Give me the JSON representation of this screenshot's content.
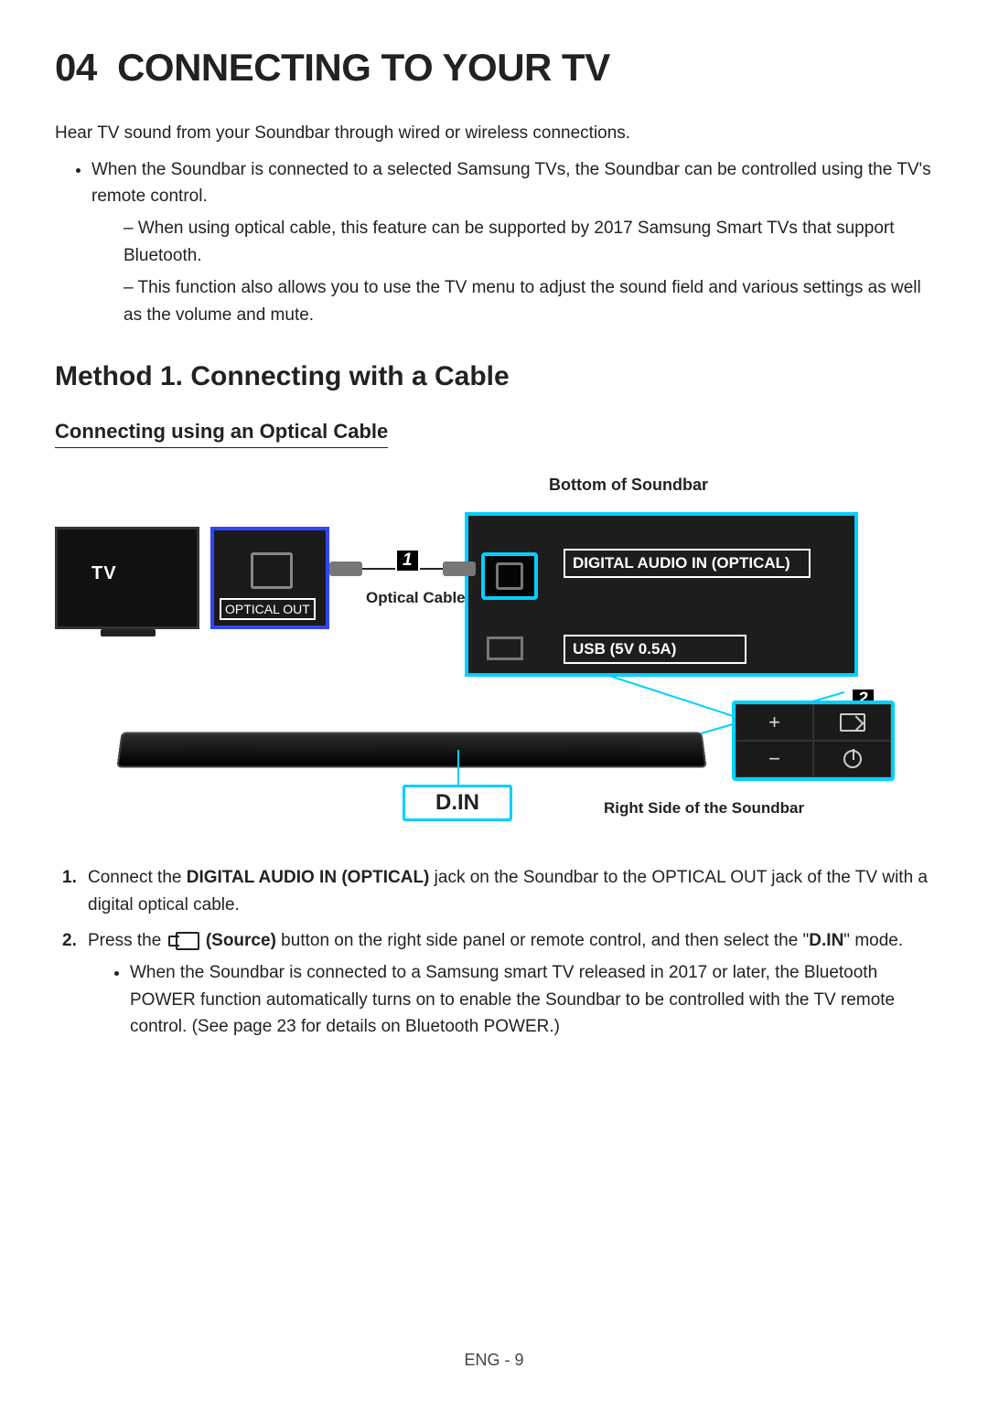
{
  "section_number": "04",
  "section_title": "CONNECTING TO YOUR TV",
  "intro": "Hear TV sound from your Soundbar through wired or wireless connections.",
  "bullets": [
    "When the Soundbar is connected to a selected Samsung TVs, the Soundbar can be controlled using the TV's remote control."
  ],
  "dashes": [
    "When using optical cable, this feature can be supported by 2017 Samsung Smart TVs that support Bluetooth.",
    "This function also allows you to use the TV menu to adjust the sound field and various settings as well as the volume and mute."
  ],
  "method_heading": "Method 1. Connecting with a Cable",
  "subsection_heading": "Connecting using an Optical Cable",
  "diagram": {
    "bottom_label": "Bottom of Soundbar",
    "tv_label": "TV",
    "tv_port_label": "OPTICAL OUT",
    "cable_label": "Optical Cable",
    "digital_in_label": "DIGITAL AUDIO IN (OPTICAL)",
    "usb_label": "USB (5V 0.5A)",
    "din_label": "D.IN",
    "rightside_label": "Right Side of the Soundbar",
    "callout1": "1",
    "callout2": "2",
    "buttons": {
      "plus": "+",
      "minus": "−"
    }
  },
  "steps": [
    {
      "num": "1.",
      "text_before_bold": "Connect the ",
      "bold": "DIGITAL AUDIO IN (OPTICAL)",
      "text_after_bold": " jack on the Soundbar to the OPTICAL OUT jack of the TV with a digital optical cable."
    },
    {
      "num": "2.",
      "text_before_icon": "Press the ",
      "source_label": "(Source)",
      "text_mid": " button on the right side panel or remote control, and then select the \"",
      "din_bold": "D.IN",
      "text_end": "\" mode.",
      "sub": "When the Soundbar is connected to a Samsung smart TV released in 2017 or later, the Bluetooth POWER function automatically turns on to enable the Soundbar to be controlled with the TV remote control. (See page 23 for details on Bluetooth POWER.)"
    }
  ],
  "footer": "ENG - 9"
}
